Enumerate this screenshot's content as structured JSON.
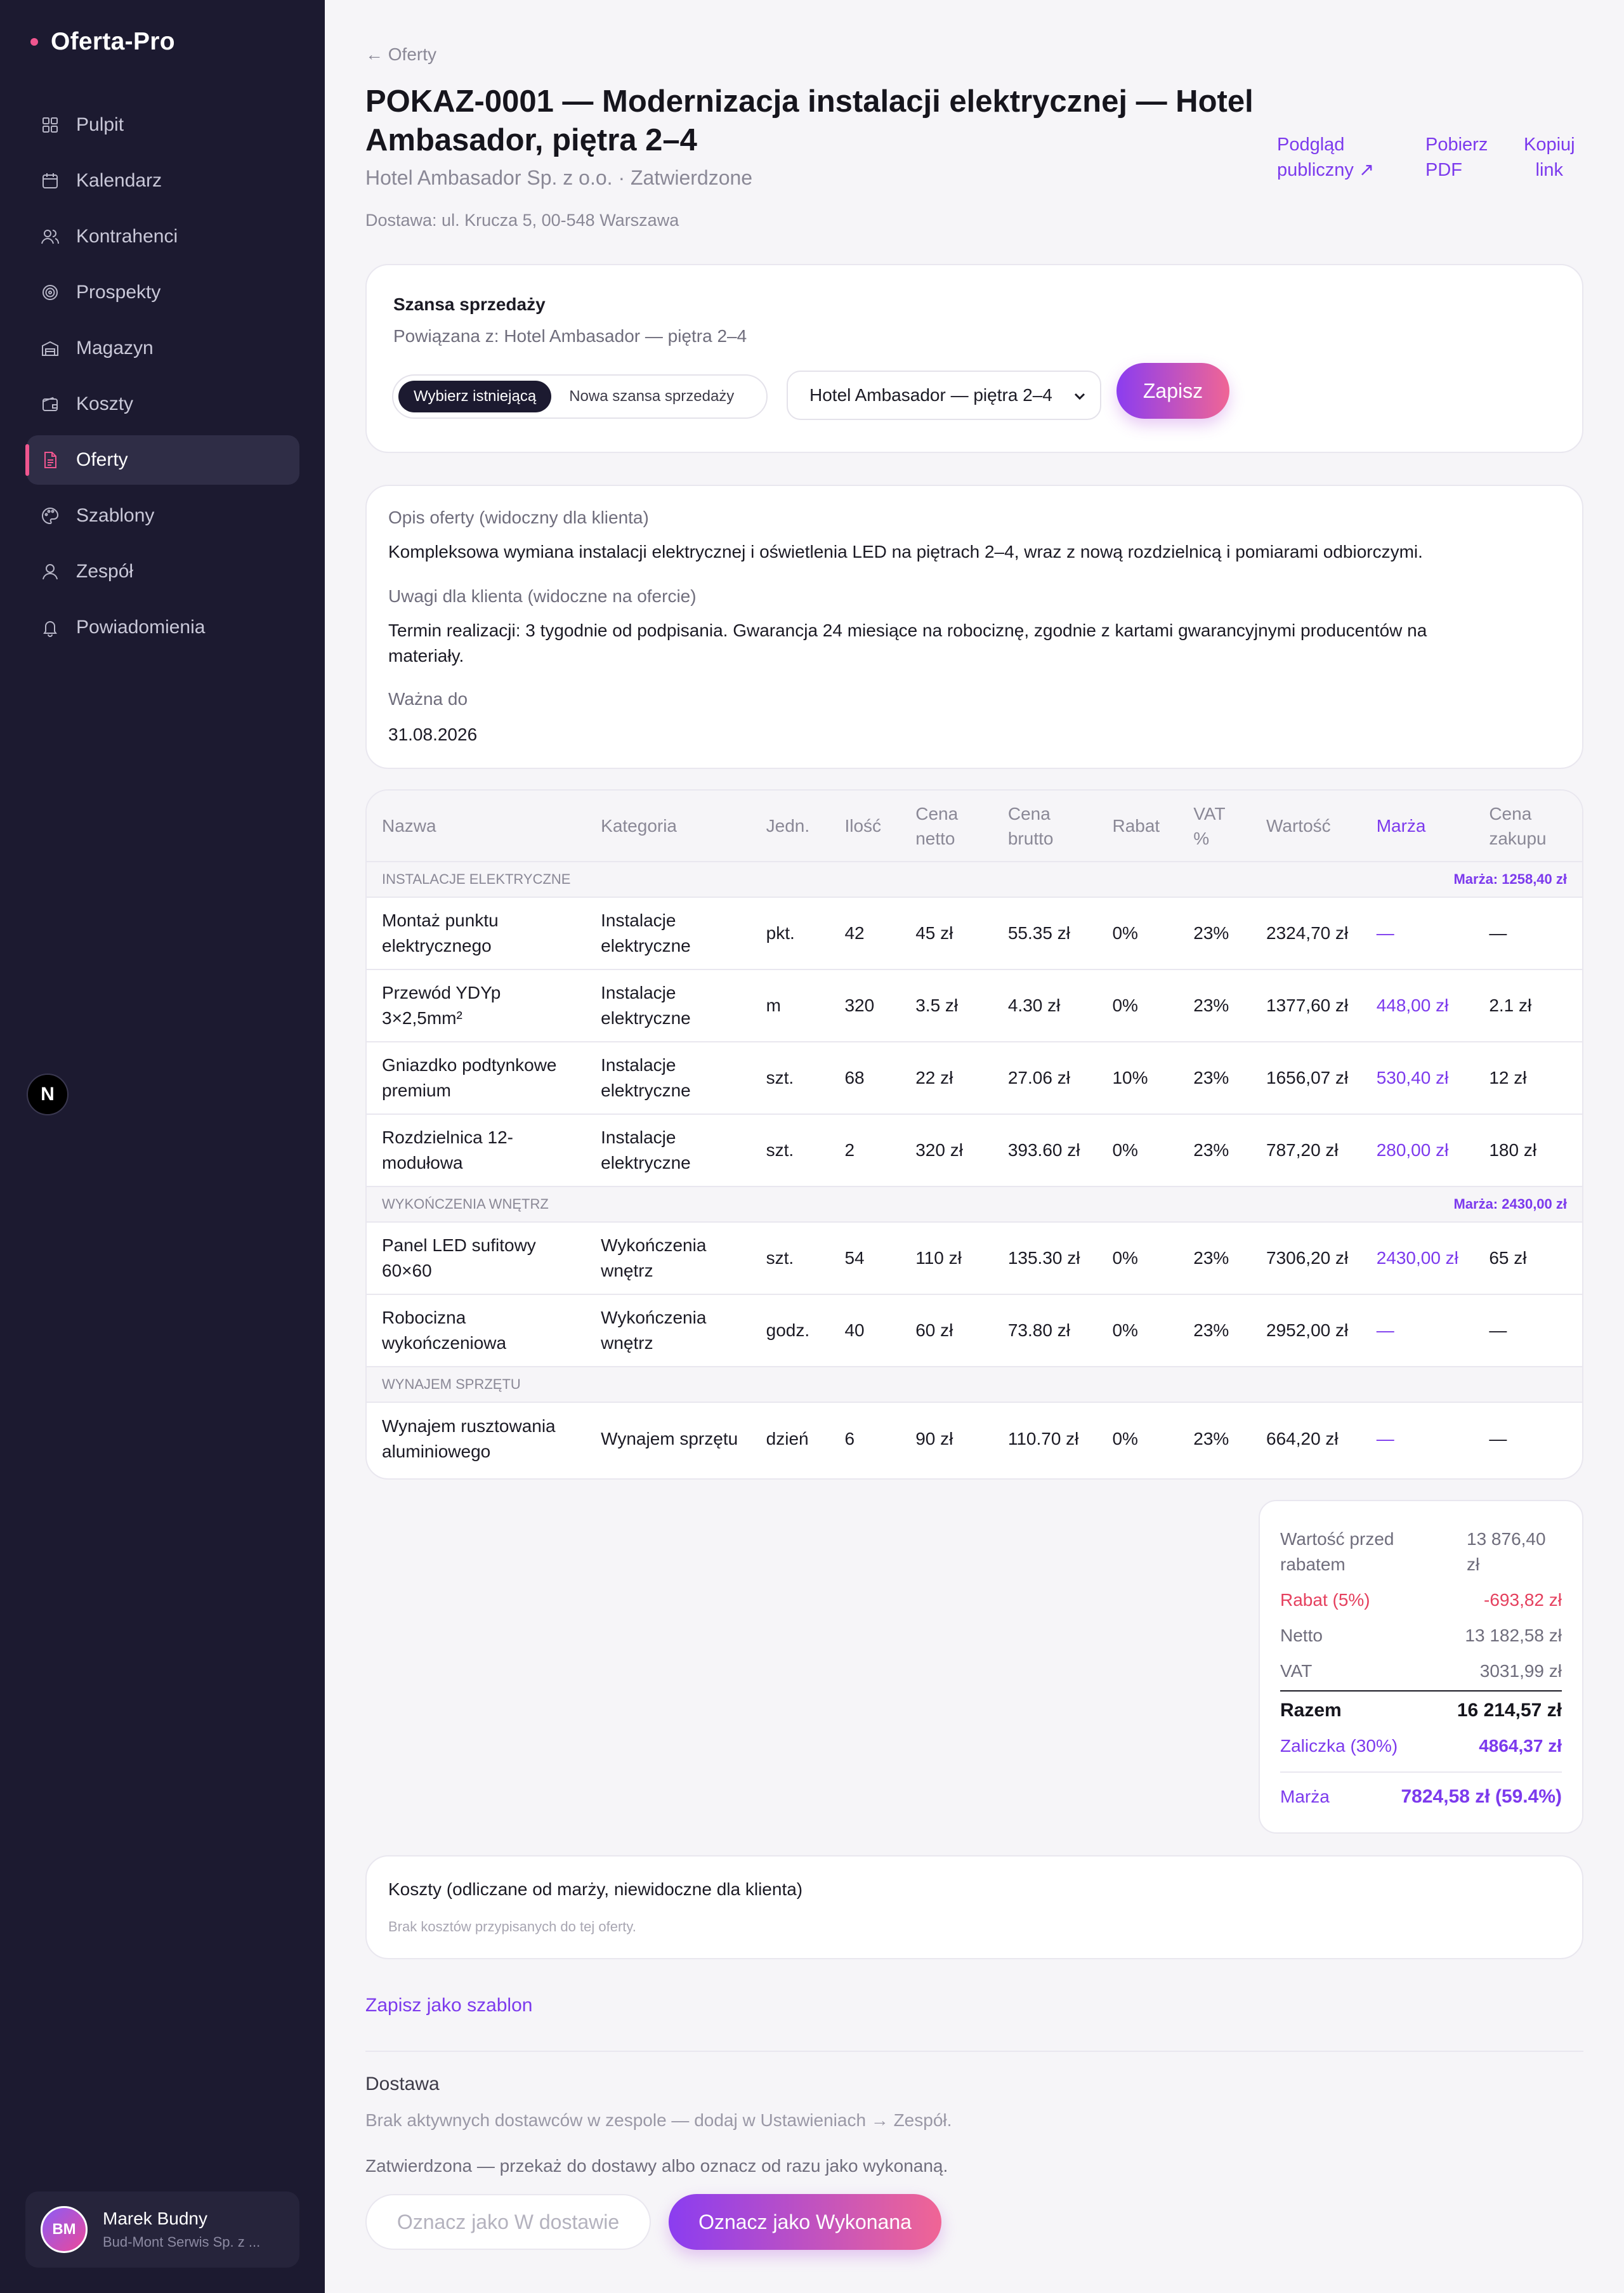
{
  "app": {
    "name": "Oferta-Pro"
  },
  "nav": [
    {
      "label": "Pulpit",
      "icon": "grid-icon"
    },
    {
      "label": "Kalendarz",
      "icon": "calendar-icon"
    },
    {
      "label": "Kontrahenci",
      "icon": "users-icon"
    },
    {
      "label": "Prospekty",
      "icon": "target-icon"
    },
    {
      "label": "Magazyn",
      "icon": "warehouse-icon"
    },
    {
      "label": "Koszty",
      "icon": "wallet-icon"
    },
    {
      "label": "Oferty",
      "icon": "document-icon",
      "active": true
    },
    {
      "label": "Szablony",
      "icon": "palette-icon"
    },
    {
      "label": "Zespół",
      "icon": "team-icon"
    },
    {
      "label": "Powiadomienia",
      "icon": "bell-icon"
    }
  ],
  "badge": "N",
  "user": {
    "initials": "BM",
    "name": "Marek Budny",
    "org": "Bud-Mont Serwis Sp. z ..."
  },
  "header": {
    "back": "← Oferty",
    "title": "POKAZ-0001 — Modernizacja instalacji elektrycznej — Hotel Ambasador, piętra 2–4",
    "subtitle": "Hotel Ambasador Sp. z o.o. · Zatwierdzone",
    "delivery": "Dostawa: ul. Krucza 5, 00-548 Warszawa",
    "public_preview_1": "Podgląd",
    "public_preview_2": "publiczny ↗",
    "pdf_1": "Pobierz",
    "pdf_2": "PDF",
    "copy_1": "Kopiuj",
    "copy_2": "link"
  },
  "opportunity": {
    "title": "Szansa sprzedaży",
    "linked": "Powiązana z: Hotel Ambasador — piętra 2–4",
    "choose_existing": "Wybierz istniejącą",
    "new_opportunity": "Nowa szansa sprzedaży",
    "selected": "Hotel Ambasador — piętra 2–4",
    "save": "Zapisz"
  },
  "description": {
    "label": "Opis oferty (widoczny dla klienta)",
    "text": "Kompleksowa wymiana instalacji elektrycznej i oświetlenia LED na piętrach 2–4, wraz z nową rozdzielnicą i pomiarami odbiorczymi.",
    "notes_label": "Uwagi dla klienta (widoczne na ofercie)",
    "notes": "Termin realizacji: 3 tygodnie od podpisania. Gwarancja 24 miesiące na robociznę, zgodnie z kartami gwarancyjnymi producentów na materiały.",
    "valid_label": "Ważna do",
    "valid": "31.08.2026"
  },
  "table": {
    "headers": {
      "name": "Nazwa",
      "category": "Kategoria",
      "unit": "Jedn.",
      "qty": "Ilość",
      "net1": "Cena",
      "net2": "netto",
      "gross1": "Cena",
      "gross2": "brutto",
      "discount": "Rabat",
      "vat1": "VAT",
      "vat2": "%",
      "value": "Wartość",
      "margin": "Marża",
      "buy1": "Cena",
      "buy2": "zakupu"
    },
    "groups": [
      {
        "name": "Instalacje elektryczne",
        "margin": "Marża: 1258,40 zł",
        "rows": [
          {
            "name": "Montaż punktu elektrycznego",
            "category": "Instalacje elektryczne",
            "unit": "pkt.",
            "qty": "42",
            "net": "45 zł",
            "gross": "55.35 zł",
            "discount": "0%",
            "vat": "23%",
            "value": "2324,70 zł",
            "margin": "—",
            "buy": "—"
          },
          {
            "name": "Przewód YDYp 3×2,5mm²",
            "category": "Instalacje elektryczne",
            "unit": "m",
            "qty": "320",
            "net": "3.5 zł",
            "gross": "4.30 zł",
            "discount": "0%",
            "vat": "23%",
            "value": "1377,60 zł",
            "margin": "448,00 zł",
            "buy": "2.1 zł"
          },
          {
            "name": "Gniazdko podtynkowe premium",
            "category": "Instalacje elektryczne",
            "unit": "szt.",
            "qty": "68",
            "net": "22 zł",
            "gross": "27.06 zł",
            "discount": "10%",
            "vat": "23%",
            "value": "1656,07 zł",
            "margin": "530,40 zł",
            "buy": "12 zł"
          },
          {
            "name": "Rozdzielnica 12-modułowa",
            "category": "Instalacje elektryczne",
            "unit": "szt.",
            "qty": "2",
            "net": "320 zł",
            "gross": "393.60 zł",
            "discount": "0%",
            "vat": "23%",
            "value": "787,20 zł",
            "margin": "280,00 zł",
            "buy": "180 zł"
          }
        ]
      },
      {
        "name": "Wykończenia wnętrz",
        "margin": "Marża: 2430,00 zł",
        "rows": [
          {
            "name": "Panel LED sufitowy 60×60",
            "category": "Wykończenia wnętrz",
            "unit": "szt.",
            "qty": "54",
            "net": "110 zł",
            "gross": "135.30 zł",
            "discount": "0%",
            "vat": "23%",
            "value": "7306,20 zł",
            "margin": "2430,00 zł",
            "buy": "65 zł"
          },
          {
            "name": "Robocizna wykończeniowa",
            "category": "Wykończenia wnętrz",
            "unit": "godz.",
            "qty": "40",
            "net": "60 zł",
            "gross": "73.80 zł",
            "discount": "0%",
            "vat": "23%",
            "value": "2952,00 zł",
            "margin": "—",
            "buy": "—"
          }
        ]
      },
      {
        "name": "Wynajem sprzętu",
        "margin": "",
        "rows": [
          {
            "name": "Wynajem rusztowania aluminiowego",
            "category": "Wynajem sprzętu",
            "unit": "dzień",
            "qty": "6",
            "net": "90 zł",
            "gross": "110.70 zł",
            "discount": "0%",
            "vat": "23%",
            "value": "664,20 zł",
            "margin": "—",
            "buy": "—"
          }
        ]
      }
    ]
  },
  "summary": {
    "before_label": "Wartość przed rabatem",
    "before": "13 876,40 zł",
    "discount_label": "Rabat (5%)",
    "discount": "-693,82 zł",
    "net_label": "Netto",
    "net": "13 182,58 zł",
    "vat_label": "VAT",
    "vat": "3031,99 zł",
    "total_label": "Razem",
    "total": "16 214,57 zł",
    "advance_label": "Zaliczka (30%)",
    "advance": "4864,37 zł",
    "margin_label": "Marża",
    "margin": "7824,58 zł (59.4%)"
  },
  "costs": {
    "title": "Koszty (odliczane od marży, niewidoczne dla klienta)",
    "empty": "Brak kosztów przypisanych do tej oferty."
  },
  "save_template": "Zapisz jako szablon",
  "delivery_section": {
    "title": "Dostawa",
    "no_couriers": "Brak aktywnych dostawców w zespole — dodaj w Ustawieniach → Zespół.",
    "hint": "Zatwierdzona — przekaż do dostawy albo oznacz od razu jako wykonaną.",
    "mark_delivery": "Oznacz jako W dostawie",
    "mark_done": "Oznacz jako Wykonana"
  },
  "colors": {
    "sidebar": "#1c1a30",
    "accent": "#7c3aed",
    "pink": "#f0568f",
    "discount": "#e5405e"
  }
}
